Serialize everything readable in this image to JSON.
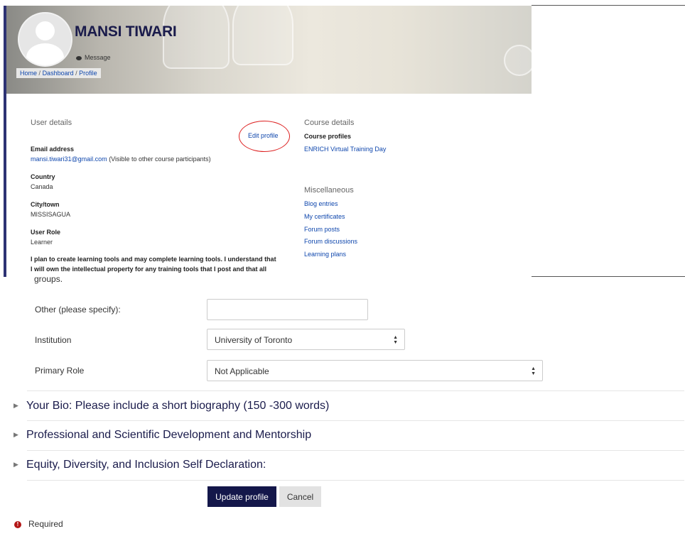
{
  "header": {
    "name": "MANSI TIWARI",
    "message_label": "Message",
    "breadcrumb": [
      "Home",
      "Dashboard",
      "Profile"
    ],
    "breadcrumb_sep": "/"
  },
  "user_details": {
    "title": "User details",
    "edit_label": "Edit profile",
    "email_label": "Email address",
    "email_value": "mansi.tiwari31@gmail.com",
    "email_note": "(Visible to other course participants)",
    "country_label": "Country",
    "country_value": "Canada",
    "city_label": "City/town",
    "city_value": "MISSISAGUA",
    "role_label": "User Role",
    "role_value": "Learner",
    "description_line1": "I plan to create learning tools and may complete learning tools. I understand that",
    "description_line2": "I will own the intellectual property for any training tools that I post and that all"
  },
  "course_details": {
    "title": "Course details",
    "profiles_label": "Course profiles",
    "course_link": "ENRICH Virtual Training Day"
  },
  "misc": {
    "title": "Miscellaneous",
    "links": [
      "Blog entries",
      "My certificates",
      "Forum posts",
      "Forum discussions",
      "Learning plans"
    ]
  },
  "form": {
    "groups_text": "groups.",
    "other_label": "Other (please specify):",
    "other_value": "",
    "institution_label": "Institution",
    "institution_value": "University of Toronto",
    "primary_role_label": "Primary Role",
    "primary_role_value": "Not Applicable",
    "sections": [
      "Your Bio: Please include a short biography (150 -300 words)",
      "Professional and Scientific Development and Mentorship",
      "Equity, Diversity, and Inclusion Self Declaration:"
    ],
    "update_label": "Update profile",
    "cancel_label": "Cancel",
    "required_label": "Required"
  },
  "colors": {
    "accent": "#14174a",
    "link": "#0f47ad",
    "required": "#b31616",
    "annotation": "#dd2222"
  }
}
